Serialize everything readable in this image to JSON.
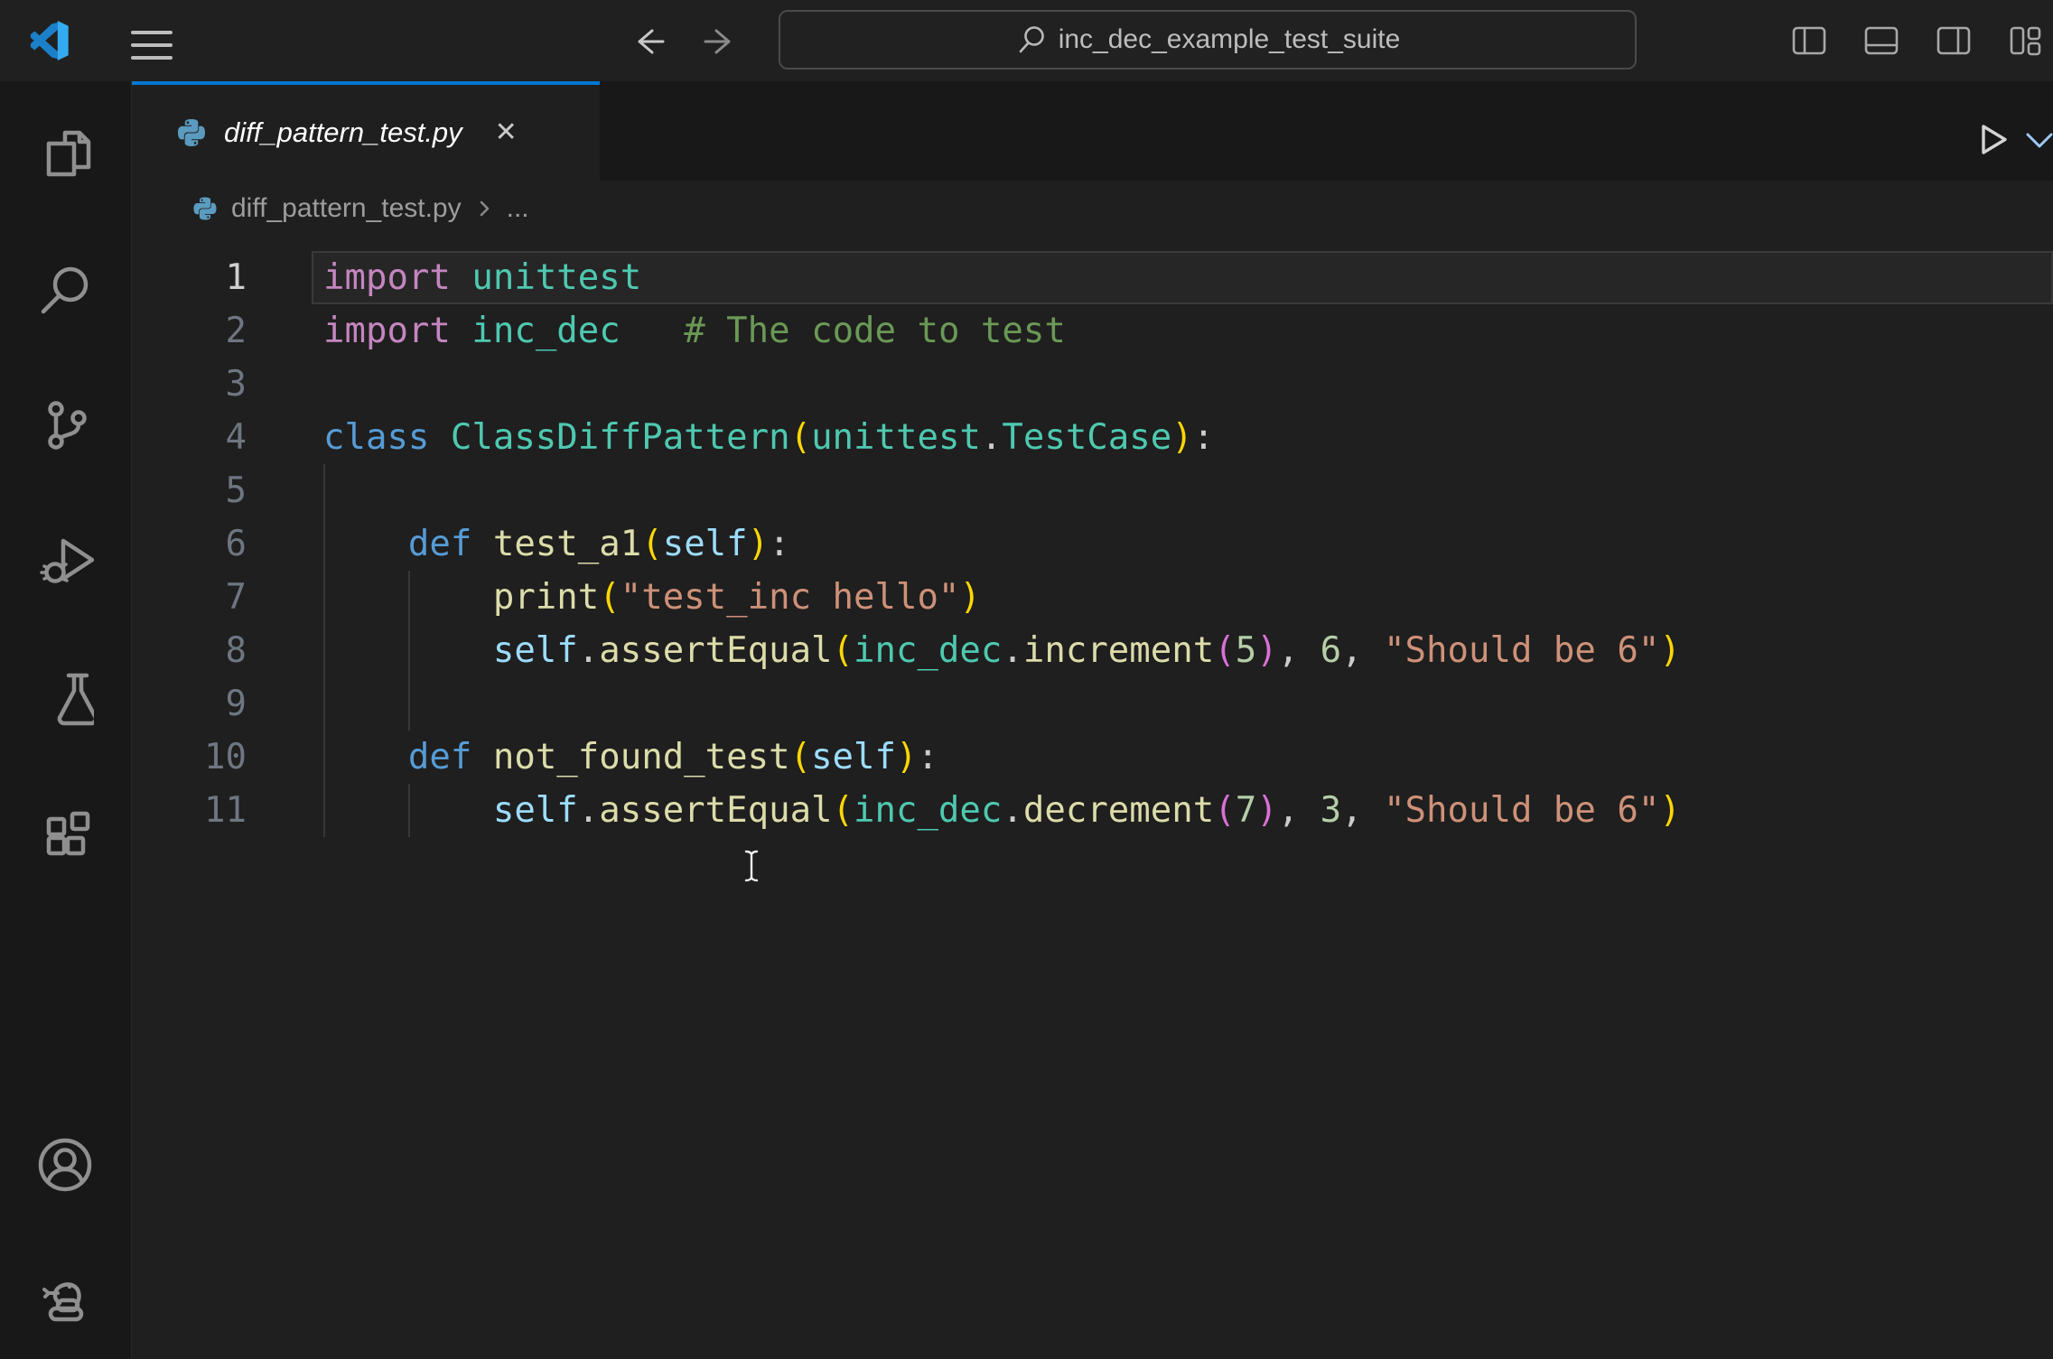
{
  "titlebar": {
    "search_value": "inc_dec_example_test_suite"
  },
  "tab": {
    "label": "diff_pattern_test.py",
    "close_glyph": "✕"
  },
  "breadcrumb": {
    "file": "diff_pattern_test.py",
    "overflow": "..."
  },
  "editor": {
    "active_line": 1,
    "lines": [
      [
        [
          "import",
          "kw"
        ],
        [
          " ",
          "pln"
        ],
        [
          "unittest",
          "type"
        ]
      ],
      [
        [
          "import",
          "kw"
        ],
        [
          " ",
          "pln"
        ],
        [
          "inc_dec",
          "type"
        ],
        [
          "   ",
          "pln"
        ],
        [
          "# The code to test",
          "cmt"
        ]
      ],
      [],
      [
        [
          "class",
          "ctrl"
        ],
        [
          " ",
          "pln"
        ],
        [
          "ClassDiffPattern",
          "type"
        ],
        [
          "(",
          "br1"
        ],
        [
          "unittest",
          "type"
        ],
        [
          ".",
          "pln"
        ],
        [
          "TestCase",
          "type"
        ],
        [
          ")",
          "br1"
        ],
        [
          ":",
          "pln"
        ]
      ],
      [],
      [
        [
          "    ",
          "pln"
        ],
        [
          "def",
          "ctrl"
        ],
        [
          " ",
          "pln"
        ],
        [
          "test_a1",
          "fn"
        ],
        [
          "(",
          "br1"
        ],
        [
          "self",
          "self"
        ],
        [
          ")",
          "br1"
        ],
        [
          ":",
          "pln"
        ]
      ],
      [
        [
          "        ",
          "pln"
        ],
        [
          "print",
          "fn"
        ],
        [
          "(",
          "br1"
        ],
        [
          "\"test_inc hello\"",
          "str"
        ],
        [
          ")",
          "br1"
        ]
      ],
      [
        [
          "        ",
          "pln"
        ],
        [
          "self",
          "self"
        ],
        [
          ".",
          "pln"
        ],
        [
          "assertEqual",
          "fn"
        ],
        [
          "(",
          "br1"
        ],
        [
          "inc_dec",
          "type"
        ],
        [
          ".",
          "pln"
        ],
        [
          "increment",
          "fn"
        ],
        [
          "(",
          "br2"
        ],
        [
          "5",
          "num"
        ],
        [
          ")",
          "br2"
        ],
        [
          ",",
          "pln"
        ],
        [
          " ",
          "pln"
        ],
        [
          "6",
          "num"
        ],
        [
          ",",
          "pln"
        ],
        [
          " ",
          "pln"
        ],
        [
          "\"Should be 6\"",
          "str"
        ],
        [
          ")",
          "br1"
        ]
      ],
      [],
      [
        [
          "    ",
          "pln"
        ],
        [
          "def",
          "ctrl"
        ],
        [
          " ",
          "pln"
        ],
        [
          "not_found_test",
          "fn"
        ],
        [
          "(",
          "br1"
        ],
        [
          "self",
          "self"
        ],
        [
          ")",
          "br1"
        ],
        [
          ":",
          "pln"
        ]
      ],
      [
        [
          "        ",
          "pln"
        ],
        [
          "self",
          "self"
        ],
        [
          ".",
          "pln"
        ],
        [
          "assertEqual",
          "fn"
        ],
        [
          "(",
          "br1"
        ],
        [
          "inc_dec",
          "type"
        ],
        [
          ".",
          "pln"
        ],
        [
          "decrement",
          "fn"
        ],
        [
          "(",
          "br2"
        ],
        [
          "7",
          "num"
        ],
        [
          ")",
          "br2"
        ],
        [
          ",",
          "pln"
        ],
        [
          " ",
          "pln"
        ],
        [
          "3",
          "num"
        ],
        [
          ",",
          "pln"
        ],
        [
          " ",
          "pln"
        ],
        [
          "\"Should be 6\"",
          "str"
        ],
        [
          ")",
          "br1"
        ]
      ]
    ]
  },
  "colors": {
    "accent_tab_border": "#0078d4",
    "editor_background": "#1f1f1f",
    "bar_background": "#181818",
    "python_icon": "#5b9bc0",
    "logo_blue_bright": "#34abf0",
    "logo_blue_dark": "#1b80c8"
  }
}
